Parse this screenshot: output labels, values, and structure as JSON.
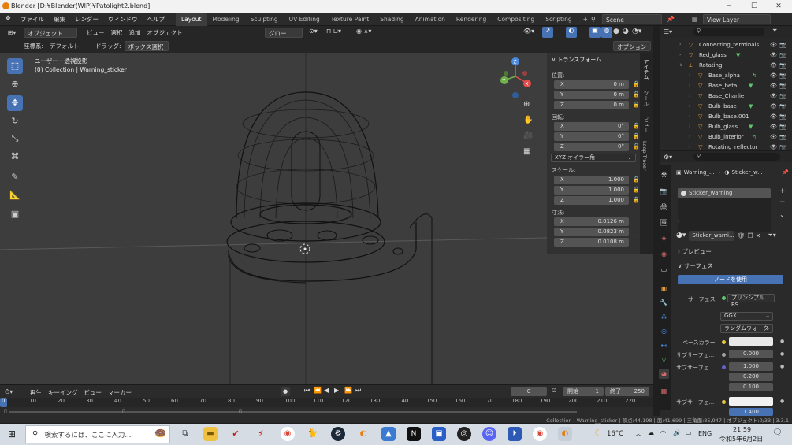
{
  "window": {
    "title": "Blender [D:¥Blender(WIP)¥Patolight2.blend]",
    "minimize": "─",
    "maximize": "☐",
    "close": "✕"
  },
  "topbar": {
    "menus": [
      "ファイル",
      "編集",
      "レンダー",
      "ウィンドウ",
      "ヘルプ"
    ],
    "workspaces": [
      "Layout",
      "Modeling",
      "Sculpting",
      "UV Editing",
      "Texture Paint",
      "Shading",
      "Animation",
      "Rendering",
      "Compositing",
      "Scripting"
    ],
    "add_tab": "+",
    "scene": "Scene",
    "view_layer": "View Layer"
  },
  "viewport_header": {
    "mode": "オブジェクト...",
    "menus": [
      "ビュー",
      "選択",
      "追加",
      "オブジェクト"
    ],
    "transform_orientation": "グロー...",
    "options_label": "オプション",
    "coord_label": "座標系:",
    "coord_value": "デフォルト",
    "drag_label": "ドラッグ:",
    "drag_value": "ボックス選択"
  },
  "viewport": {
    "view_name": "ユーザー・透視投影",
    "collection_info": "(0) Collection | Warning_sticker",
    "gizmo": {
      "x": "X",
      "y": "Y",
      "z": "Z"
    }
  },
  "npanel": {
    "section": "トランスフォーム",
    "location_label": "位置:",
    "location": [
      {
        "axis": "X",
        "value": "0 m"
      },
      {
        "axis": "Y",
        "value": "0 m"
      },
      {
        "axis": "Z",
        "value": "0 m"
      }
    ],
    "rotation_label": "回転:",
    "rotation": [
      {
        "axis": "X",
        "value": "0°"
      },
      {
        "axis": "Y",
        "value": "0°"
      },
      {
        "axis": "Z",
        "value": "0°"
      }
    ],
    "rotation_mode": "XYZ オイラー角",
    "scale_label": "スケール:",
    "scale": [
      {
        "axis": "X",
        "value": "1.000"
      },
      {
        "axis": "Y",
        "value": "1.000"
      },
      {
        "axis": "Z",
        "value": "1.000"
      }
    ],
    "dimensions_label": "寸法:",
    "dimensions": [
      {
        "axis": "X",
        "value": "0.0126 m"
      },
      {
        "axis": "Y",
        "value": "0.0823 m"
      },
      {
        "axis": "Z",
        "value": "0.0108 m"
      }
    ],
    "tabs": [
      "アイテム",
      "ツール",
      "ビュー",
      "Loop Tracer"
    ]
  },
  "outliner": {
    "items": [
      {
        "name": "Connecting_terminals"
      },
      {
        "name": "Red_glass"
      },
      {
        "name": "Rotating"
      },
      {
        "name": "Base_alpha"
      },
      {
        "name": "Base_beta"
      },
      {
        "name": "Base_Charlie"
      },
      {
        "name": "Bulb_base"
      },
      {
        "name": "Bulb_base.001"
      },
      {
        "name": "Bulb_glass"
      },
      {
        "name": "Bulb_interior"
      },
      {
        "name": "Rotating_reflector"
      }
    ]
  },
  "properties": {
    "breadcrumb_object": "Warning_...",
    "breadcrumb_material": "Sticker_w...",
    "material_slot": "Sticker_warning",
    "material_name": "Sticker_warni...",
    "preview_label": "プレビュー",
    "surface_label": "サーフェス",
    "use_nodes": "ノードを使用",
    "surface_field_label": "サーフェス",
    "surface_value": "プリンシプルBS...",
    "distribution": "GGX",
    "subsurface_method": "ランダムウォーク",
    "base_color_label": "ベースカラー",
    "subsurface_label": "サブサーフェ...",
    "subsurface_value": "0.000",
    "subsurface_radius_label": "サブサーフェ...",
    "subsurface_radius": [
      "1.000",
      "0.200",
      "0.100"
    ],
    "subsurface_color_label": "サブサーフェ...",
    "partial_value": "1.400",
    "colors": {
      "base": "#e8e8e8",
      "subsurface_color": "#f2f2f2"
    }
  },
  "timeline": {
    "menus": [
      "再生",
      "キーイング",
      "ビュー",
      "マーカー"
    ],
    "current_frame": "0",
    "start_label": "開始",
    "start": "1",
    "end_label": "終了",
    "end": "250",
    "ticks": [
      "0",
      "10",
      "20",
      "30",
      "40",
      "50",
      "60",
      "70",
      "80",
      "90",
      "100",
      "110",
      "120",
      "130",
      "140",
      "150",
      "160",
      "170",
      "180",
      "190",
      "200",
      "210",
      "220"
    ]
  },
  "statusbar": {
    "text": "Collection | Warning_sticker | 頂点:44,198 | 面:41,699 | 三角面:85,947 | オブジェクト:0/33 | 3.3.1"
  },
  "taskbar": {
    "search_placeholder": "検索するには、ここに入力...",
    "weather": "16°C",
    "ime": "ENG",
    "time": "21:59",
    "date": "令和5年6月2日"
  }
}
